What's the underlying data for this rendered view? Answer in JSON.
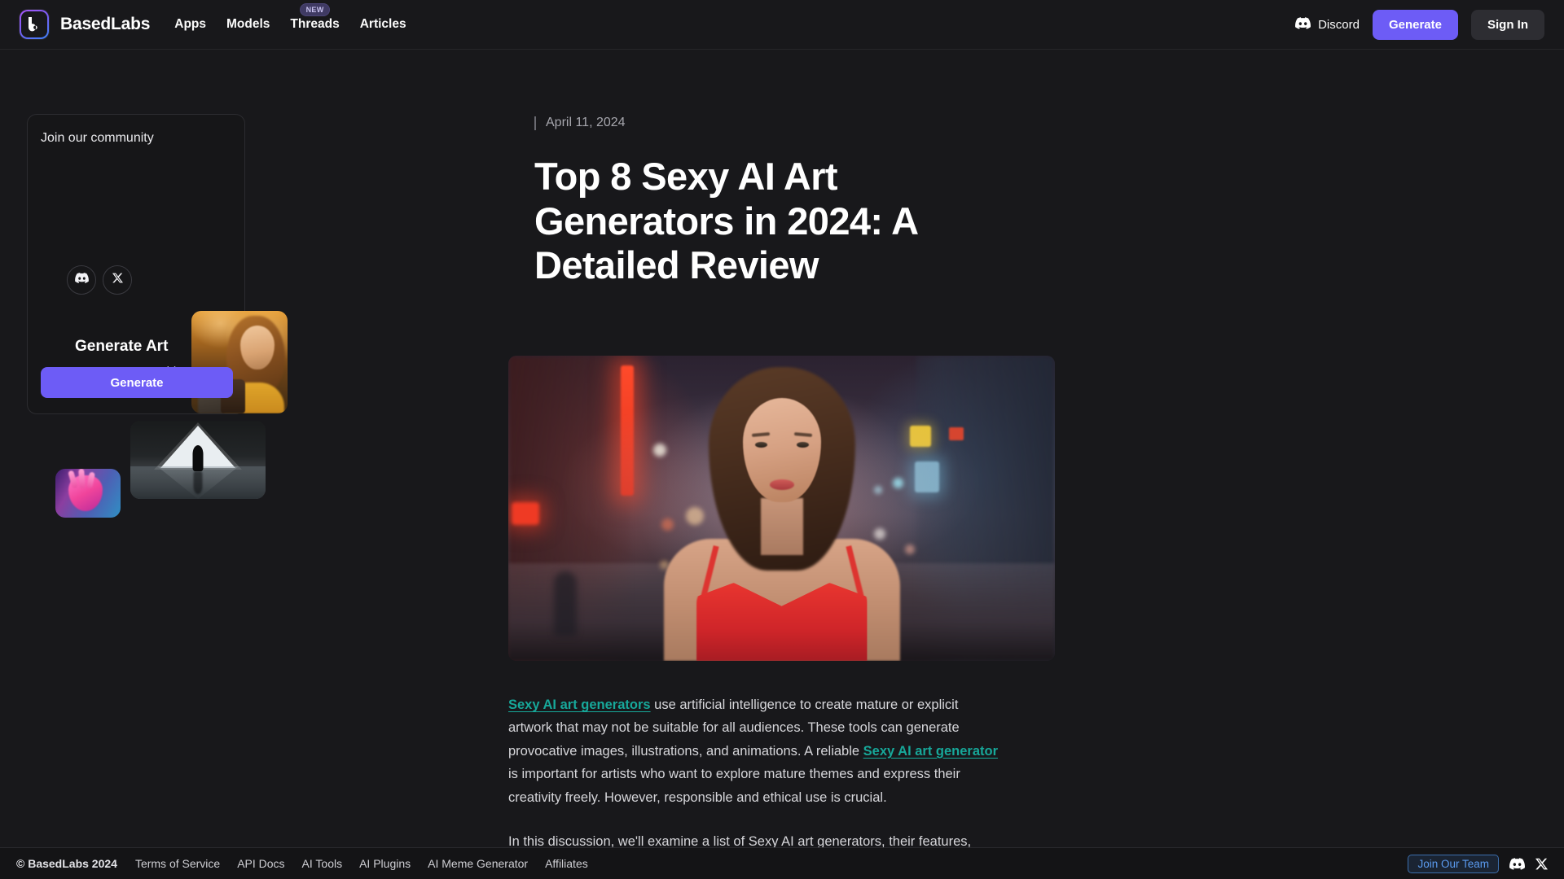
{
  "header": {
    "brand_name": "BasedLabs",
    "nav": [
      {
        "label": "Apps",
        "badge": ""
      },
      {
        "label": "Models",
        "badge": ""
      },
      {
        "label": "Threads",
        "badge": "NEW"
      },
      {
        "label": "Articles",
        "badge": ""
      }
    ],
    "discord_label": "Discord",
    "generate_label": "Generate",
    "signin_label": "Sign In",
    "accent_color": "#6d5cf6"
  },
  "sidebar": {
    "community_title": "Join our community",
    "socials": [
      {
        "name": "discord",
        "label": "Discord"
      },
      {
        "name": "x-twitter",
        "label": "X"
      }
    ],
    "promo_heading": "Generate Art",
    "promo_sub": "Generate an AI video or image here.",
    "generate_label": "Generate",
    "thumbnails": [
      {
        "name": "portrait-golden-hour",
        "alt": "Woman holding a coffee cup at golden hour"
      },
      {
        "name": "neon-triangle-corridor",
        "alt": "Silhouette in a glowing triangular corridor"
      },
      {
        "name": "neon-hand",
        "alt": "Neon pink hand on blue gradient"
      }
    ]
  },
  "article": {
    "date": "April 11, 2024",
    "title": "Top 8 Sexy AI Art Generators in 2024: A Detailed Review",
    "hero_alt": "Woman in a red dress on a foggy neon-lit night street",
    "paragraphs": [
      {
        "segments": [
          {
            "text": "Sexy AI art generators",
            "link": true
          },
          {
            "text": " use artificial intelligence to create mature or explicit artwork that may not be suitable for all audiences. These tools can generate provocative images, illustrations, and animations. A reliable ",
            "link": false
          },
          {
            "text": "Sexy AI art generator",
            "link": true
          },
          {
            "text": " is important for artists who want to explore mature themes and express their creativity freely. However, responsible and ethical use is crucial.",
            "link": false
          }
        ]
      },
      {
        "segments": [
          {
            "text": "In this discussion, we'll examine a list of Sexy AI art generators, their features, pros, and cons to help artists choose the right tool for their needs.",
            "link": false
          }
        ]
      }
    ],
    "link_color": "#17a89a"
  },
  "footer": {
    "copyright": "© BasedLabs 2024",
    "links": [
      "Terms of Service",
      "API Docs",
      "AI Tools",
      "AI Plugins",
      "AI Meme Generator",
      "Affiliates"
    ],
    "join_team_label": "Join Our Team",
    "social_icons": [
      {
        "name": "discord",
        "label": "Discord"
      },
      {
        "name": "x-twitter",
        "label": "X"
      }
    ]
  }
}
